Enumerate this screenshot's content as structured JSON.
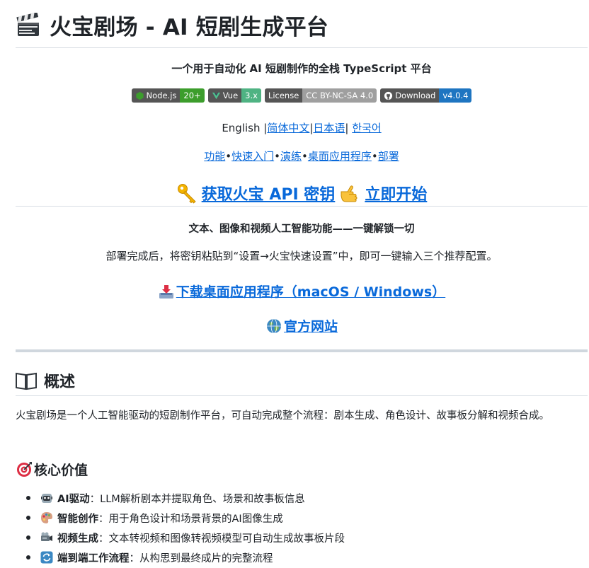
{
  "header": {
    "title": "火宝剧场 - AI 短剧生成平台",
    "subtitle": "一个用于自动化 AI 短剧制作的全栈 TypeScript 平台"
  },
  "badges": [
    {
      "label": "Node.js",
      "value": "20+",
      "value_color": "#3c9d2c",
      "icon": "nodejs-icon"
    },
    {
      "label": "Vue",
      "value": "3.x",
      "value_color": "#4fb383",
      "icon": "vue-icon"
    },
    {
      "label": "License",
      "value": "CC BY-NC-SA 4.0",
      "value_color": "#9f9f9f",
      "icon": ""
    },
    {
      "label": "Download",
      "value": "v4.0.4",
      "value_color": "#1e75c1",
      "icon": "github-icon"
    }
  ],
  "languages": {
    "current": "English",
    "sep": "|",
    "links": [
      "简体中文",
      "日本语",
      "한국어"
    ]
  },
  "nav": {
    "dot": "•",
    "links": [
      "功能",
      "快速入门",
      "演练",
      "桌面应用程序",
      "部署"
    ]
  },
  "cta": {
    "api_key": "获取火宝 API 密钥",
    "start": "立即开始"
  },
  "features": {
    "heading": "文本、图像和视频人工智能功能——一键解锁一切",
    "deploy_note": "部署完成后，将密钥粘贴到“设置→火宝快速设置”中，即可一键输入三个推荐配置。"
  },
  "download": {
    "label": "下载桌面应用程序（macOS / Windows）"
  },
  "website": {
    "label": "官方网站"
  },
  "overview": {
    "heading": "概述",
    "text": "火宝剧场是一个人工智能驱动的短剧制作平台，可自动完成整个流程：剧本生成、角色设计、故事板分解和视频合成。"
  },
  "core_values": {
    "heading": "核心价值",
    "items": [
      {
        "term": "AI驱动",
        "sep": "：",
        "desc": "LLM解析剧本并提取角色、场景和故事板信息",
        "icon": "robot-icon"
      },
      {
        "term": "智能创作",
        "sep": "：",
        "desc": "用于角色设计和场景背景的AI图像生成",
        "icon": "palette-icon"
      },
      {
        "term": "视频生成",
        "sep": "：",
        "desc": "文本转视频和图像转视频模型可自动生成故事板片段",
        "icon": "film-projector-icon"
      },
      {
        "term": "端到端工作流程",
        "sep": "：",
        "desc": "从构思到最终成片的完整流程",
        "icon": "cycle-icon"
      }
    ]
  },
  "colors": {
    "link": "#0969da",
    "text": "#1f2328",
    "border": "#d8dee4"
  }
}
